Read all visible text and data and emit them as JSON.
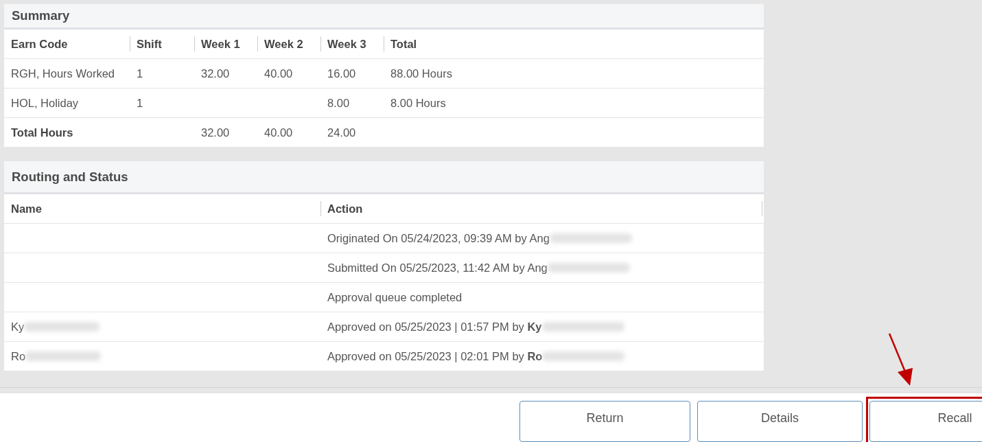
{
  "summary": {
    "title": "Summary",
    "columns": [
      "Earn Code",
      "Shift",
      "Week 1",
      "Week 2",
      "Week 3",
      "Total"
    ],
    "rows": [
      {
        "kind": "line",
        "cells": [
          "RGH, Hours Worked",
          "1",
          "32.00",
          "40.00",
          "16.00",
          "88.00 Hours"
        ]
      },
      {
        "kind": "line",
        "cells": [
          "HOL, Holiday",
          "1",
          "",
          "",
          "8.00",
          "8.00 Hours"
        ]
      },
      {
        "kind": "total",
        "cells": [
          "Total Hours",
          "",
          "32.00",
          "40.00",
          "24.00",
          ""
        ]
      }
    ]
  },
  "routing": {
    "title": "Routing and Status",
    "columns": [
      "Name",
      "Action"
    ],
    "rows": [
      {
        "name": "",
        "action": "Originated On 05/24/2023, 09:39 AM by Ang",
        "redacted": true
      },
      {
        "name": "",
        "action": "Submitted On 05/25/2023, 11:42 AM by Ang",
        "redacted": true
      },
      {
        "name": "",
        "action": "Approval queue completed",
        "redacted": false
      },
      {
        "name": "Ky",
        "action": "Approved on 05/25/2023 | 01:57 PM by **Ky**",
        "redacted": true
      },
      {
        "name": "Ro",
        "action": "Approved on 05/25/2023 | 02:01 PM by **Ro**",
        "redacted": true
      }
    ]
  },
  "buttons": [
    {
      "label": "Return",
      "highlighted": false
    },
    {
      "label": "Details",
      "highlighted": false
    },
    {
      "label": "Recall",
      "highlighted": true
    }
  ]
}
